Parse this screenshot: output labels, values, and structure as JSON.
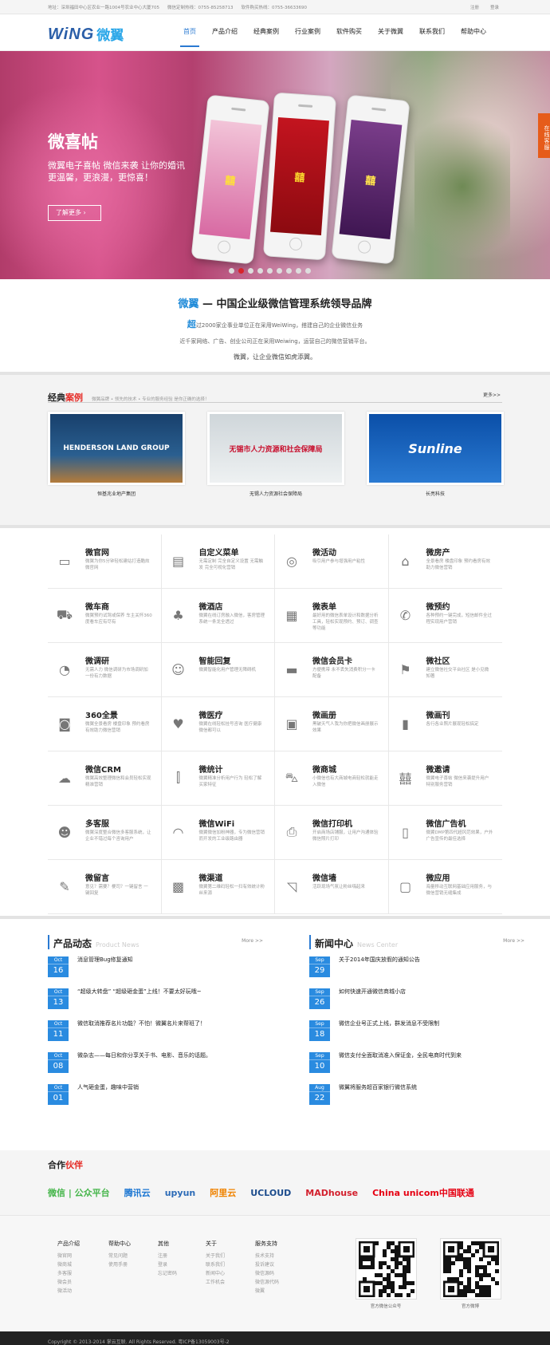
{
  "topbar": {
    "address": "地址：深圳福田中心区农业一路1004号农业中心大厦705",
    "phone1": "微信定制热线：0755-85258713",
    "phone2": "软件购买热线：0755-36633690",
    "register": "注册",
    "login": "登录"
  },
  "logo": {
    "en": "WiNG",
    "cn": "微翼"
  },
  "nav": [
    "首页",
    "产品介绍",
    "经典案例",
    "行业案例",
    "软件购买",
    "关于微翼",
    "联系我们",
    "帮助中心"
  ],
  "banner": {
    "title": "微喜帖",
    "sub": "微翼电子喜帖 微信来袭 让你的婚讯更温馨，更浪漫，更惊喜！",
    "button": "了解更多",
    "side_tab": "在线客服"
  },
  "intro": {
    "brand": "微翼",
    "title": "— 中国企业级微信管理系统领导品牌",
    "line1_big": "超",
    "line1": "过2000家企事业单位正在采用WeiWing，搭建自己的企业微信业务",
    "line2": "近千家网络、广告、创业公司正在采用Weiwing，运营自己的微信营销平台。",
    "line3": "微翼，让企业微信如虎添翼。"
  },
  "cases": {
    "title_a": "经典",
    "title_b": "案例",
    "sub": "微翼品牌 • 领先的技术 • 专业的服务经验 是你正确的选择！",
    "more": "更多>>",
    "items": [
      {
        "caption": "恒基兆业地产集团",
        "img_text": "HENDERSON LAND GROUP",
        "color": "#0d3b6b"
      },
      {
        "caption": "无锡人力资源社会保障局",
        "img_text": "无锡市人力资源和社会保障局",
        "color": "#c8102e"
      },
      {
        "caption": "长亮科技",
        "img_text": "Sunline",
        "color": "#0a57b3"
      }
    ]
  },
  "features": [
    {
      "icon": "window-icon",
      "glyph": "▭",
      "title": "微官网",
      "desc": "微翼为你5分钟轻松建站打造酷炫微官网"
    },
    {
      "icon": "menu-icon",
      "glyph": "▤",
      "title": "自定义菜单",
      "desc": "无需定制 完全自定义设置 无需触发 完全可视化营销"
    },
    {
      "icon": "activity-icon",
      "glyph": "◎",
      "title": "微活动",
      "desc": "吸引用户参与增强用户粘性"
    },
    {
      "icon": "house-icon",
      "glyph": "⌂",
      "title": "微房产",
      "desc": "全景看房 楼盘印象 预约看房有效助力微信营销"
    },
    {
      "icon": "car-icon",
      "glyph": "⛟",
      "title": "微车商",
      "desc": "微翼预约试驾或保养 车主关怀360度看车应有尽有"
    },
    {
      "icon": "lamp-icon",
      "glyph": "♣",
      "title": "微酒店",
      "desc": "微翼在线订房融入微信，客房管理系统一条龙全透过"
    },
    {
      "icon": "calendar-icon",
      "glyph": "▦",
      "title": "微表单",
      "desc": "最好用的微信表单设计和数据分析工具，轻松实现预约、预订、调查等功能"
    },
    {
      "icon": "phone-icon",
      "glyph": "✆",
      "title": "微预约",
      "desc": "各种预约一键完成，短信邮件全过程实现用户营销"
    },
    {
      "icon": "chart-icon",
      "glyph": "◔",
      "title": "微调研",
      "desc": "无需人力 微信调研为市场调研加一份有力数据"
    },
    {
      "icon": "face-icon",
      "glyph": "☺",
      "title": "智能回复",
      "desc": "微翼智能化用户管理无障碍机"
    },
    {
      "icon": "card-icon",
      "glyph": "▬",
      "title": "微信会员卡",
      "desc": "方便携带 永不丢失消费积分一卡配备"
    },
    {
      "icon": "community-icon",
      "glyph": "⚑",
      "title": "微社区",
      "desc": "建立微信社交平台社区 是小见微知著"
    },
    {
      "icon": "camera-icon",
      "glyph": "◙",
      "title": "360全景",
      "desc": "微翼全景看房 楼盘印象 预约看房有效助力微信营销"
    },
    {
      "icon": "heart-icon",
      "glyph": "♥",
      "title": "微医疗",
      "desc": "微翼在线轻松挂号咨询 医疗健康 微信都可以"
    },
    {
      "icon": "album-icon",
      "glyph": "▣",
      "title": "微画册",
      "desc": "黑破天气人我为你把微信画册展示效果"
    },
    {
      "icon": "magazine-icon",
      "glyph": "▮",
      "title": "微画刊",
      "desc": "各行各业照片展现轻松搞定"
    },
    {
      "icon": "chat-icon",
      "glyph": "☁",
      "title": "微信CRM",
      "desc": "微翼高效整理微信和会员轻松实现精准营销"
    },
    {
      "icon": "stats-icon",
      "glyph": "⫿",
      "title": "微统计",
      "desc": "微翼精准分析用户行为 轻松了解买家特征"
    },
    {
      "icon": "cart-icon",
      "glyph": "⛍",
      "title": "微商城",
      "desc": "小微信也有大商城电商轻松就能走入微信"
    },
    {
      "icon": "invite-icon",
      "glyph": "囍",
      "title": "微邀请",
      "desc": "微翼电子喜帖 微信来袭提升用户特别服务营销"
    },
    {
      "icon": "service-icon",
      "glyph": "☻",
      "title": "多客服",
      "desc": "微翼深度整合微信多客服系统，让企业不错过每个咨询用户"
    },
    {
      "icon": "wifi-icon",
      "glyph": "◠",
      "title": "微信WiFi",
      "desc": "微翼微信加粉神器，专为微信营销而开发的工业级路由器"
    },
    {
      "icon": "printer-icon",
      "glyph": "⎙",
      "title": "微信打印机",
      "desc": "开启商场店铺服，让用户沟通体验微信照片打印"
    },
    {
      "icon": "ad-icon",
      "glyph": "▯",
      "title": "微信广告机",
      "desc": "微翼DMP第四代超风范效果，户外广告宣传的最佳选择"
    },
    {
      "icon": "message-icon",
      "glyph": "✎",
      "title": "微留言",
      "desc": "意见？需要？梗司？一键留言 一键回复"
    },
    {
      "icon": "qrcode-icon",
      "glyph": "▩",
      "title": "微渠道",
      "desc": "微翼第二维码轻松一扫有效统计粉丝来源"
    },
    {
      "icon": "wall-icon",
      "glyph": "◹",
      "title": "微信墙",
      "desc": "活跃现场气氛让粉丝嗨起来"
    },
    {
      "icon": "apps-icon",
      "glyph": "▢",
      "title": "微应用",
      "desc": "海量移动互联网基础应用服务，与微信营销无缝集成"
    }
  ],
  "news": {
    "product": {
      "title": "产品动态",
      "en": "Product News",
      "more": "More >>",
      "items": [
        {
          "mo": "Oct",
          "dy": "16",
          "text": "消息管理Bug修复通知"
        },
        {
          "mo": "Oct",
          "dy": "13",
          "text": "“超级大转盘” “超级砸金蛋”上线！不要太好玩哦~"
        },
        {
          "mo": "Oct",
          "dy": "11",
          "text": "微信取消推荐名片功能？不怕！微翼名片来帮班了！"
        },
        {
          "mo": "Oct",
          "dy": "08",
          "text": "微杂志——每日和你分享关于书、电影、音乐的话题。"
        },
        {
          "mo": "Oct",
          "dy": "01",
          "text": "人气砸金蛋，趣味中营销"
        }
      ]
    },
    "center": {
      "title": "新闻中心",
      "en": "News Center",
      "more": "More >>",
      "items": [
        {
          "mo": "Sep",
          "dy": "29",
          "text": "关于2014年国庆放假的通知公告"
        },
        {
          "mo": "Sep",
          "dy": "26",
          "text": "如何快速开通微信商城小店"
        },
        {
          "mo": "Sep",
          "dy": "18",
          "text": "微信企业号正式上线，群发消息不受限制"
        },
        {
          "mo": "Sep",
          "dy": "10",
          "text": "微信支付全面取消准入保证金，全民电商时代到来"
        },
        {
          "mo": "Aug",
          "dy": "22",
          "text": "微翼将服务超百家银行微信系统"
        }
      ]
    }
  },
  "partners": {
    "title_a": "合作",
    "title_b": "伙伴",
    "items": [
      {
        "name": "微信 | 公众平台",
        "color": "#44b549"
      },
      {
        "name": "腾讯云",
        "color": "#1b76d2"
      },
      {
        "name": "upyun",
        "color": "#2c6bb7"
      },
      {
        "name": "阿里云",
        "color": "#f08300"
      },
      {
        "name": "UCLOUD",
        "color": "#1b4b8c"
      },
      {
        "name": "MADhouse",
        "color": "#d3202d"
      },
      {
        "name": "China unicom中国联通",
        "color": "#e60012"
      }
    ]
  },
  "footer": {
    "cols": [
      {
        "h": "产品介绍",
        "i": [
          "微官网",
          "微商城",
          "多客服",
          "微会员",
          "微活动"
        ]
      },
      {
        "h": "帮助中心",
        "i": [
          "常见问题",
          "使用手册"
        ]
      },
      {
        "h": "其他",
        "i": [
          "注册",
          "登录",
          "忘记密码"
        ]
      },
      {
        "h": "关于",
        "i": [
          "关于我们",
          "联系我们",
          "新闻中心",
          "工作机会"
        ]
      },
      {
        "h": "服务支持",
        "i": [
          "技术支持",
          "投诉建议",
          "微信源码",
          "微信源代码",
          "微翼"
        ]
      }
    ],
    "qr1": "官方微信公众号",
    "qr2": "官方微博"
  },
  "copyright": "Copyright © 2013-2014 掌云互联. All Rights Reserved. 粤ICP备13059003号-2"
}
